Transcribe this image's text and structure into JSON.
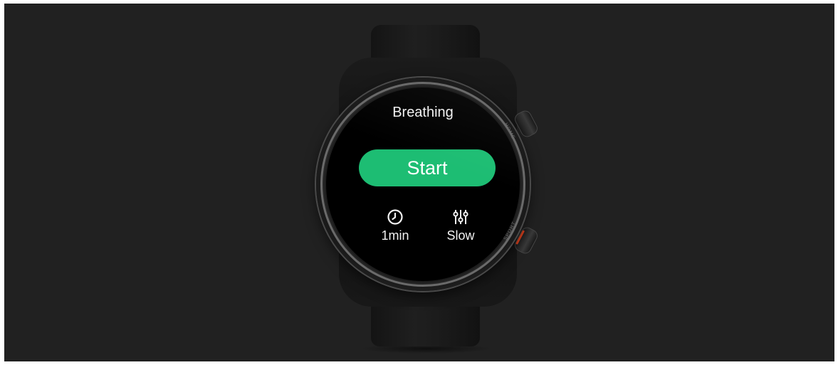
{
  "watch": {
    "screen_title": "Breathing",
    "start_button_label": "Start",
    "duration_label": "1min",
    "speed_label": "Slow",
    "accent_color": "#1dbd73",
    "crown_labels": {
      "upper": "HOME",
      "lower": "SPORT"
    }
  },
  "icons": {
    "duration": "clock-icon",
    "speed": "sliders-icon"
  }
}
